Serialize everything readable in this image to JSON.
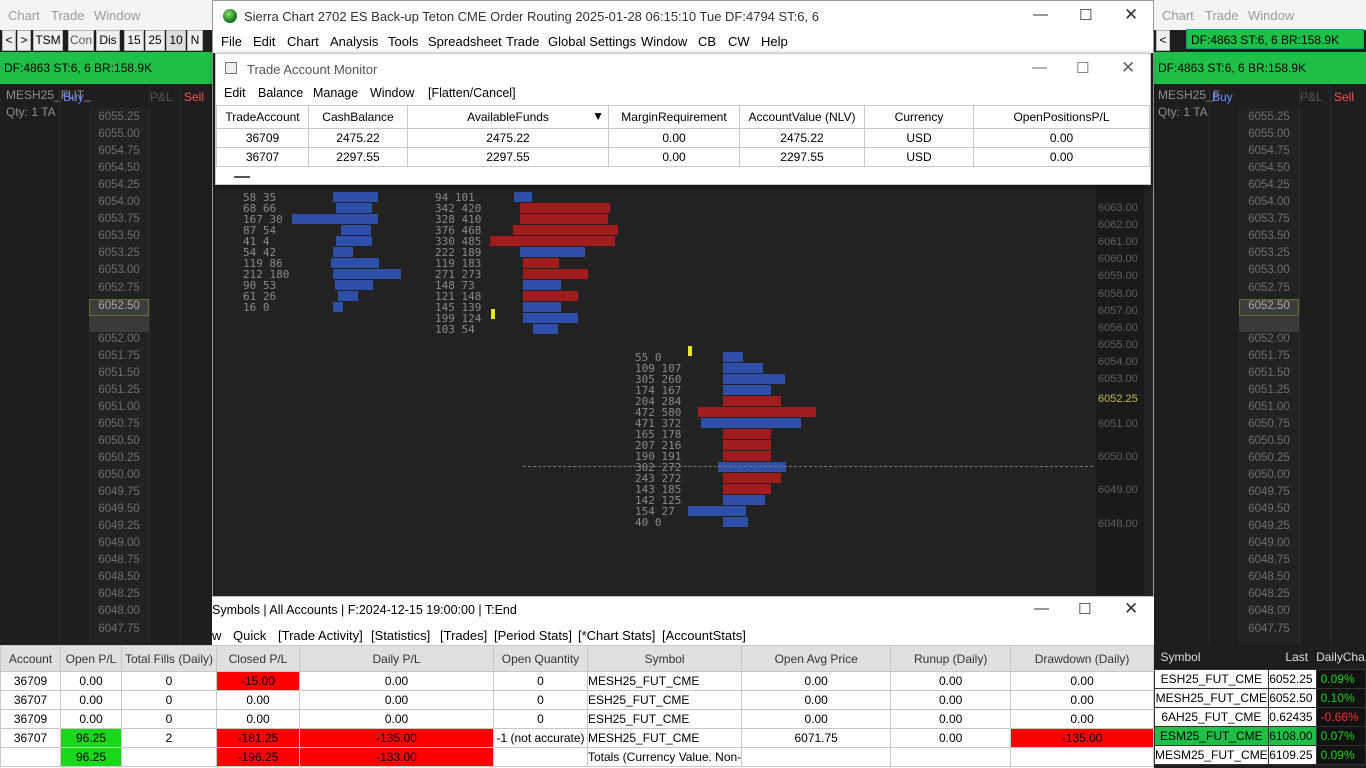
{
  "left_dom": {
    "menu": [
      "Chart",
      "Trade",
      "Window"
    ],
    "buttons": [
      "<",
      ">",
      "TSM",
      "Con",
      "Dis",
      "15",
      "25",
      "10",
      "N"
    ],
    "status": "DF:4863  ST:6, 6  BR:158.9K",
    "symbol": "MESH25_FUT_",
    "buy": "Buy",
    "pnl": "P&L",
    "sell": "Sell",
    "qty": "Qty: 1  TA",
    "prices": [
      "6055.25",
      "6055.00",
      "6054.75",
      "6054.50",
      "6054.25",
      "6054.00",
      "6053.75",
      "6053.50",
      "6053.25",
      "6053.00",
      "6052.75",
      "6052.50",
      "",
      "6052.00",
      "6051.75",
      "6051.50",
      "6051.25",
      "6051.00",
      "6050.75",
      "6050.50",
      "6050.25",
      "6050.00",
      "6049.75",
      "6049.50",
      "6049.25",
      "6049.00",
      "6048.75",
      "6048.50",
      "6048.25",
      "6048.00",
      "6047.75"
    ]
  },
  "right_dom": {
    "menu": [
      "Chart",
      "Trade",
      "Window"
    ],
    "status_top": "DF:4863  ST:6, 6  BR:158.9K",
    "status": "DF:4863  ST:6, 6  BR:158.9K",
    "symbol": "MESH25_F",
    "buy": "Buy",
    "pnl": "P&L",
    "sell": "Sell",
    "qty": "Qty: 1  TA",
    "prices": [
      "6055.25",
      "6055.00",
      "6054.75",
      "6054.50",
      "6054.25",
      "6054.00",
      "6053.75",
      "6053.50",
      "6053.25",
      "6053.00",
      "6052.75",
      "6052.50",
      "",
      "6052.00",
      "6051.75",
      "6051.50",
      "6051.25",
      "6051.00",
      "6050.75",
      "6050.50",
      "6050.25",
      "6050.00",
      "6049.75",
      "6049.50",
      "6049.25",
      "6049.00",
      "6048.75",
      "6048.50",
      "6048.25",
      "6048.00",
      "6047.75"
    ],
    "quotes_headers": [
      "Symbol",
      "Last",
      "DailyCha"
    ],
    "quotes": [
      {
        "symbol": "ESH25_FUT_CME",
        "last": "6052.25",
        "chg": "0.09%",
        "color": "#19d719"
      },
      {
        "symbol": "MESH25_FUT_CME",
        "last": "6052.50",
        "chg": "0.10%",
        "color": "#19d719"
      },
      {
        "symbol": "6AH25_FUT_CME",
        "last": "0.62435",
        "chg": "-0.66%",
        "color": "#ff3030"
      },
      {
        "symbol": "ESM25_FUT_CME",
        "last": "6108.00",
        "chg": "0.07%",
        "color": "#19d719"
      },
      {
        "symbol": "MESM25_FUT_CME",
        "last": "6109.25",
        "chg": "0.09%",
        "color": "#19d719"
      }
    ]
  },
  "main": {
    "title": "Sierra Chart 2702 ES Back-up Teton CME Order Routing 2025-01-28  06:15:10 Tue DF:4794  ST:6, 6",
    "menu": [
      "File",
      "Edit",
      "Chart",
      "Analysis",
      "Tools",
      "Spreadsheet",
      "Trade",
      "Global Settings",
      "Window",
      "CB",
      "CW",
      "Help"
    ]
  },
  "tam": {
    "title": "Trade Account Monitor",
    "menu": [
      "Edit",
      "Balance",
      "Manage",
      "Window",
      "[Flatten/Cancel]"
    ],
    "headers": [
      "TradeAccount",
      "CashBalance",
      "AvailableFunds",
      "MarginRequirement",
      "AccountValue (NLV)",
      "Currency",
      "OpenPositionsP/L"
    ],
    "rows": [
      [
        "36709",
        "2475.22",
        "2475.22",
        "0.00",
        "2475.22",
        "USD",
        "0.00"
      ],
      [
        "36707",
        "2297.55",
        "2297.55",
        "0.00",
        "2297.55",
        "USD",
        "0.00"
      ]
    ]
  },
  "chart": {
    "price_axis": [
      "6063.00",
      "6062.00",
      "6061.00",
      "6060.00",
      "6059.00",
      "6058.00",
      "6057.00",
      "6056.00",
      "6055.00",
      "6054.00",
      "6053.00",
      "6052.25",
      "6051.00",
      "6050.00",
      "6049.00",
      "6048.00"
    ],
    "last_price": "6052.25"
  },
  "trade_activity": {
    "title": "Symbols | All Accounts | F:2024-12-15  19:00:00 | T:End",
    "menu": [
      "w",
      "Quick",
      "[Trade Activity]",
      "[Statistics]",
      "[Trades]",
      "[Period Stats]",
      "[*Chart Stats]",
      "[AccountStats]"
    ],
    "headers": [
      "Account",
      "Open P/L",
      "Total Fills (Daily)",
      "Closed P/L",
      "Daily P/L",
      "Open Quantity",
      "Symbol",
      "Open Avg Price",
      "Runup (Daily)",
      "Drawdown (Daily)"
    ],
    "rows": [
      [
        "36709",
        "0.00",
        "0",
        "-15.00",
        "0.00",
        "0",
        "MESH25_FUT_CME",
        "0.00",
        "0.00",
        "0.00"
      ],
      [
        "36707",
        "0.00",
        "0",
        "0.00",
        "0.00",
        "0",
        "ESH25_FUT_CME",
        "0.00",
        "0.00",
        "0.00"
      ],
      [
        "36709",
        "0.00",
        "0",
        "0.00",
        "0.00",
        "0",
        "ESH25_FUT_CME",
        "0.00",
        "0.00",
        "0.00"
      ],
      [
        "36707",
        "96.25",
        "2",
        "-181.25",
        "-135.00",
        "-1 (not accurate)",
        "MESH25_FUT_CME",
        "6071.75",
        "0.00",
        "-135.00"
      ],
      [
        "",
        "96.25",
        "",
        "-196.25",
        "-133.00",
        "",
        "Totals (Currency Value. Non-",
        "",
        "",
        ""
      ]
    ]
  }
}
